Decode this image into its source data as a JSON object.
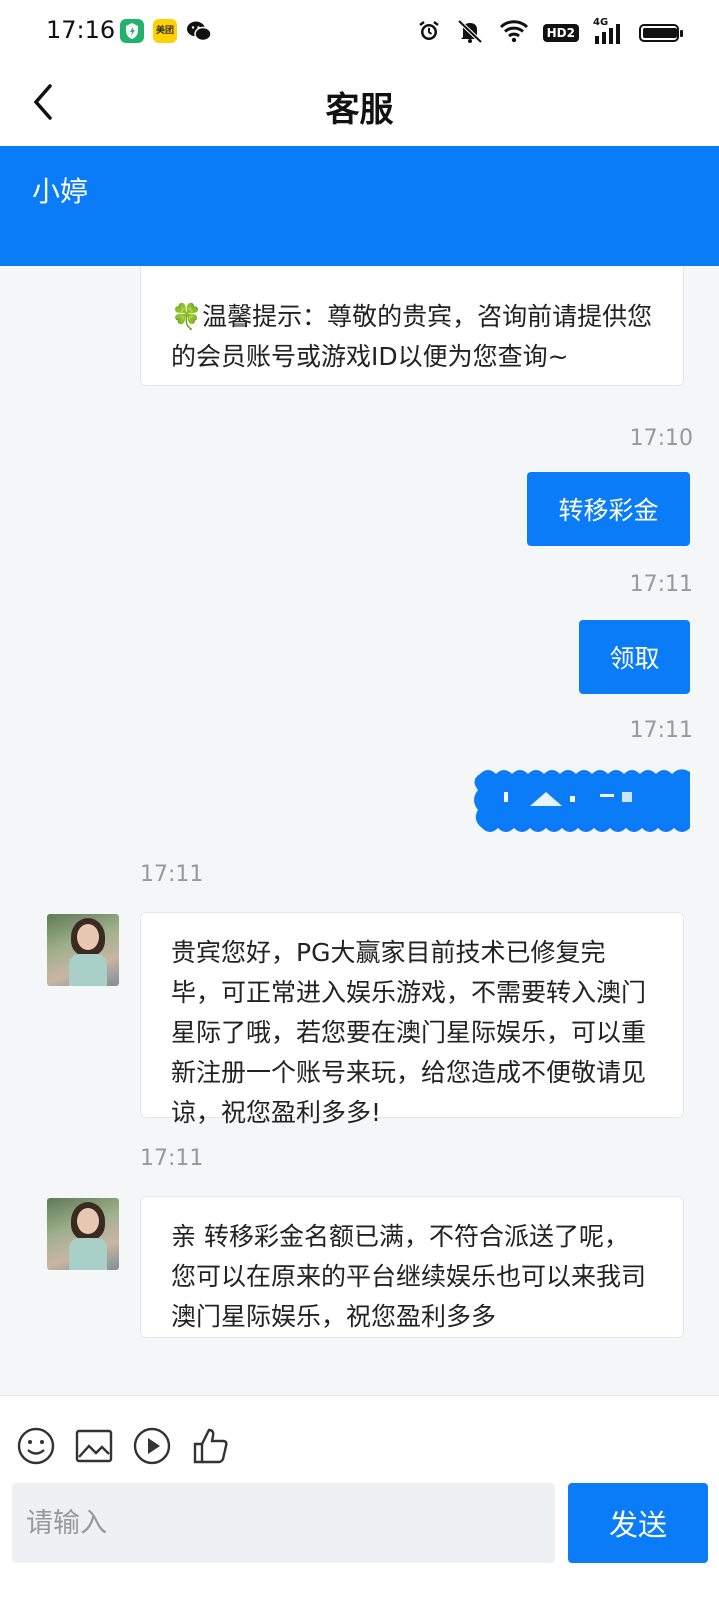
{
  "status_bar": {
    "time": "17:16",
    "app_icons": [
      {
        "name": "security-app-icon",
        "color": "#23b26d"
      },
      {
        "name": "meituan-app-icon",
        "color": "#ffd100",
        "label": "美团"
      },
      {
        "name": "wechat-app-icon",
        "color": "#111111"
      }
    ],
    "network_label": "4G",
    "hd_label": "HD2"
  },
  "header": {
    "title": "客服"
  },
  "agent": {
    "name": "小婷"
  },
  "messages": [
    {
      "type": "agent",
      "text": "🍀温馨提示：尊敬的贵宾，咨询前请提供您的会员账号或游戏ID以便为您查询~"
    },
    {
      "type": "user",
      "time": "17:10",
      "text": "转移彩金"
    },
    {
      "type": "user",
      "time": "17:11",
      "text": "领取"
    },
    {
      "type": "user",
      "time": "17:11",
      "text": ""
    },
    {
      "type": "agent",
      "time": "17:11",
      "text": "贵宾您好，PG大赢家目前技术已修复完毕，可正常进入娱乐游戏，不需要转入澳门星际了哦，若您要在澳门星际娱乐，可以重新注册一个账号来玩，给您造成不便敬请见谅，祝您盈利多多!"
    },
    {
      "type": "agent",
      "time": "17:11",
      "text": "亲 转移彩金名额已满，不符合派送了呢，您可以在原来的平台继续娱乐也可以来我司澳门星际娱乐，祝您盈利多多"
    }
  ],
  "composer": {
    "placeholder": "请输入",
    "value": "",
    "send_label": "发送",
    "tools": [
      "emoji-icon",
      "image-icon",
      "video-icon",
      "thumbs-up-icon"
    ]
  },
  "colors": {
    "accent": "#0b7cf7",
    "background": "#f5f6f8",
    "bubble": "#ffffff"
  }
}
